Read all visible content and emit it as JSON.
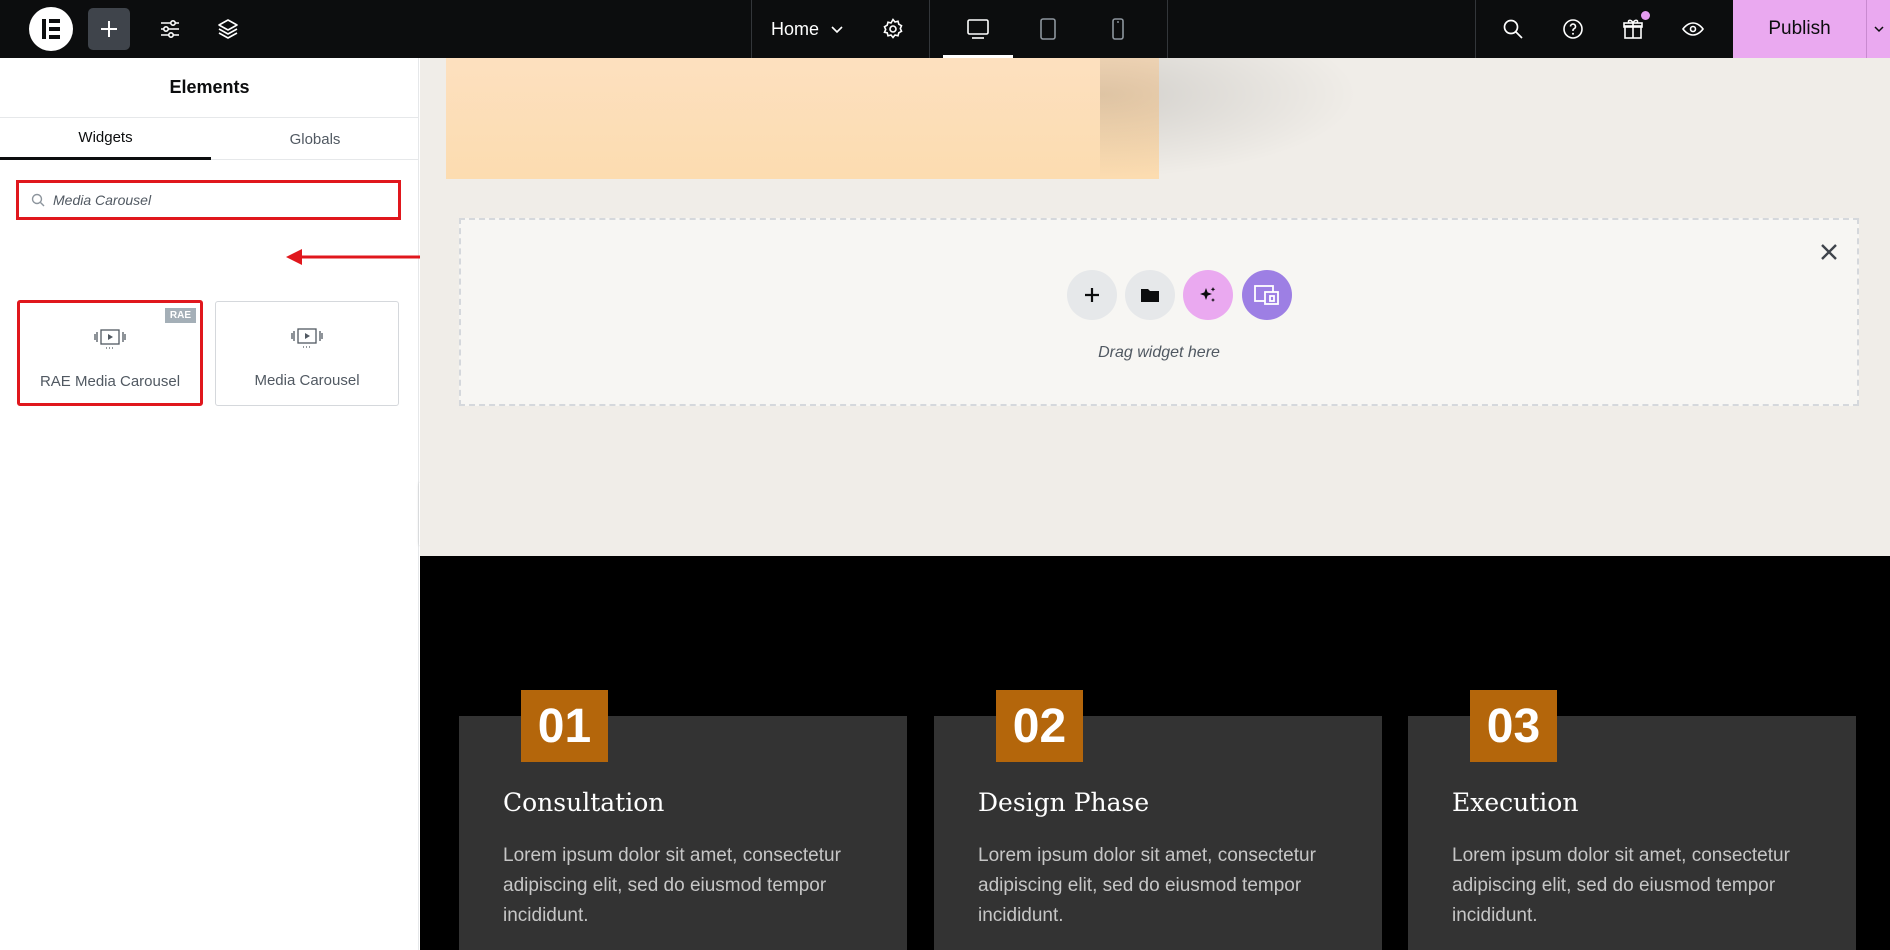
{
  "topbar": {
    "page_name": "Home",
    "publish_label": "Publish",
    "icons": [
      "elementor-logo-icon",
      "plus-icon",
      "sliders-icon",
      "layers-icon",
      "chevron-down-icon",
      "gear-icon",
      "desktop-icon",
      "tablet-icon",
      "mobile-icon",
      "search-icon",
      "help-icon",
      "gift-icon",
      "eye-icon"
    ]
  },
  "panel": {
    "title": "Elements",
    "tabs": [
      {
        "label": "Widgets",
        "active": true
      },
      {
        "label": "Globals",
        "active": false
      }
    ],
    "search_value": "Media Carousel",
    "results": [
      {
        "label": "RAE Media Carousel",
        "badge": "RAE"
      },
      {
        "label": "Media Carousel",
        "badge": ""
      }
    ]
  },
  "canvas": {
    "dropzone_text": "Drag widget here",
    "steps": [
      {
        "num": "01",
        "title": "Consultation",
        "body": "Lorem ipsum dolor sit amet, consectetur adipiscing elit, sed do eiusmod tempor incididunt."
      },
      {
        "num": "02",
        "title": "Design Phase",
        "body": "Lorem ipsum dolor sit amet, consectetur adipiscing elit, sed do eiusmod tempor incididunt."
      },
      {
        "num": "03",
        "title": "Execution",
        "body": "Lorem ipsum dolor sit amet, consectetur adipiscing elit, sed do eiusmod tempor incididunt."
      }
    ]
  },
  "colors": {
    "topbar": "#0c0d0e",
    "publish": "#eaa9f0",
    "highlight": "#e0171d",
    "step_number": "#b4660b",
    "step_card": "#333333"
  }
}
